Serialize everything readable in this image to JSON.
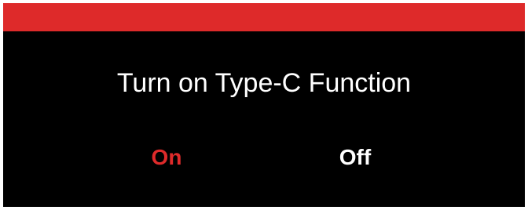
{
  "dialog": {
    "prompt": "Turn on Type-C Function",
    "options": [
      {
        "label": "On",
        "selected": true
      },
      {
        "label": "Off",
        "selected": false
      }
    ]
  },
  "colors": {
    "title_bar": "#de2a2a",
    "background": "#000000",
    "text": "#ffffff",
    "selected_option": "#de2a2a",
    "unselected_option": "#ffffff"
  }
}
